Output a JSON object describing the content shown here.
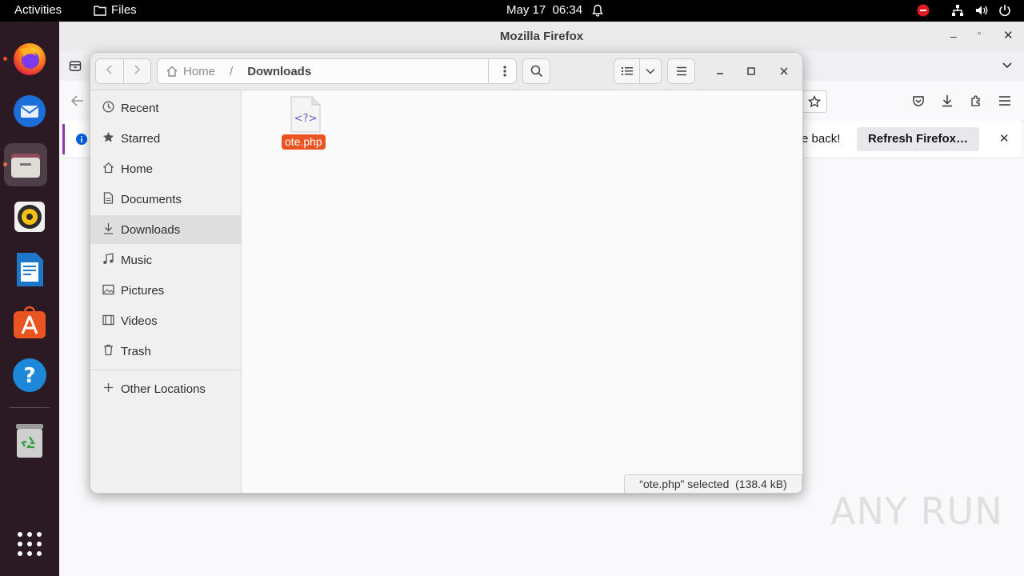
{
  "topbar": {
    "activities": "Activities",
    "app_name": "Files",
    "date": "May 17",
    "time": "06:34"
  },
  "firefox": {
    "title": "Mozilla Firefox",
    "notification_text": "e back!",
    "refresh_button": "Refresh Firefox…"
  },
  "files": {
    "path": {
      "home": "Home",
      "current": "Downloads"
    },
    "sidebar": [
      {
        "label": "Recent",
        "icon": "clock-icon"
      },
      {
        "label": "Starred",
        "icon": "star-icon"
      },
      {
        "label": "Home",
        "icon": "home-icon"
      },
      {
        "label": "Documents",
        "icon": "document-icon"
      },
      {
        "label": "Downloads",
        "icon": "download-icon"
      },
      {
        "label": "Music",
        "icon": "music-icon"
      },
      {
        "label": "Pictures",
        "icon": "picture-icon"
      },
      {
        "label": "Videos",
        "icon": "video-icon"
      },
      {
        "label": "Trash",
        "icon": "trash-icon"
      }
    ],
    "other_locations": "Other Locations",
    "file": {
      "name": "ote.php",
      "glyph": "<?>"
    },
    "status": "“ote.php” selected  (138.4 kB)"
  },
  "watermark": "ANY RUN"
}
